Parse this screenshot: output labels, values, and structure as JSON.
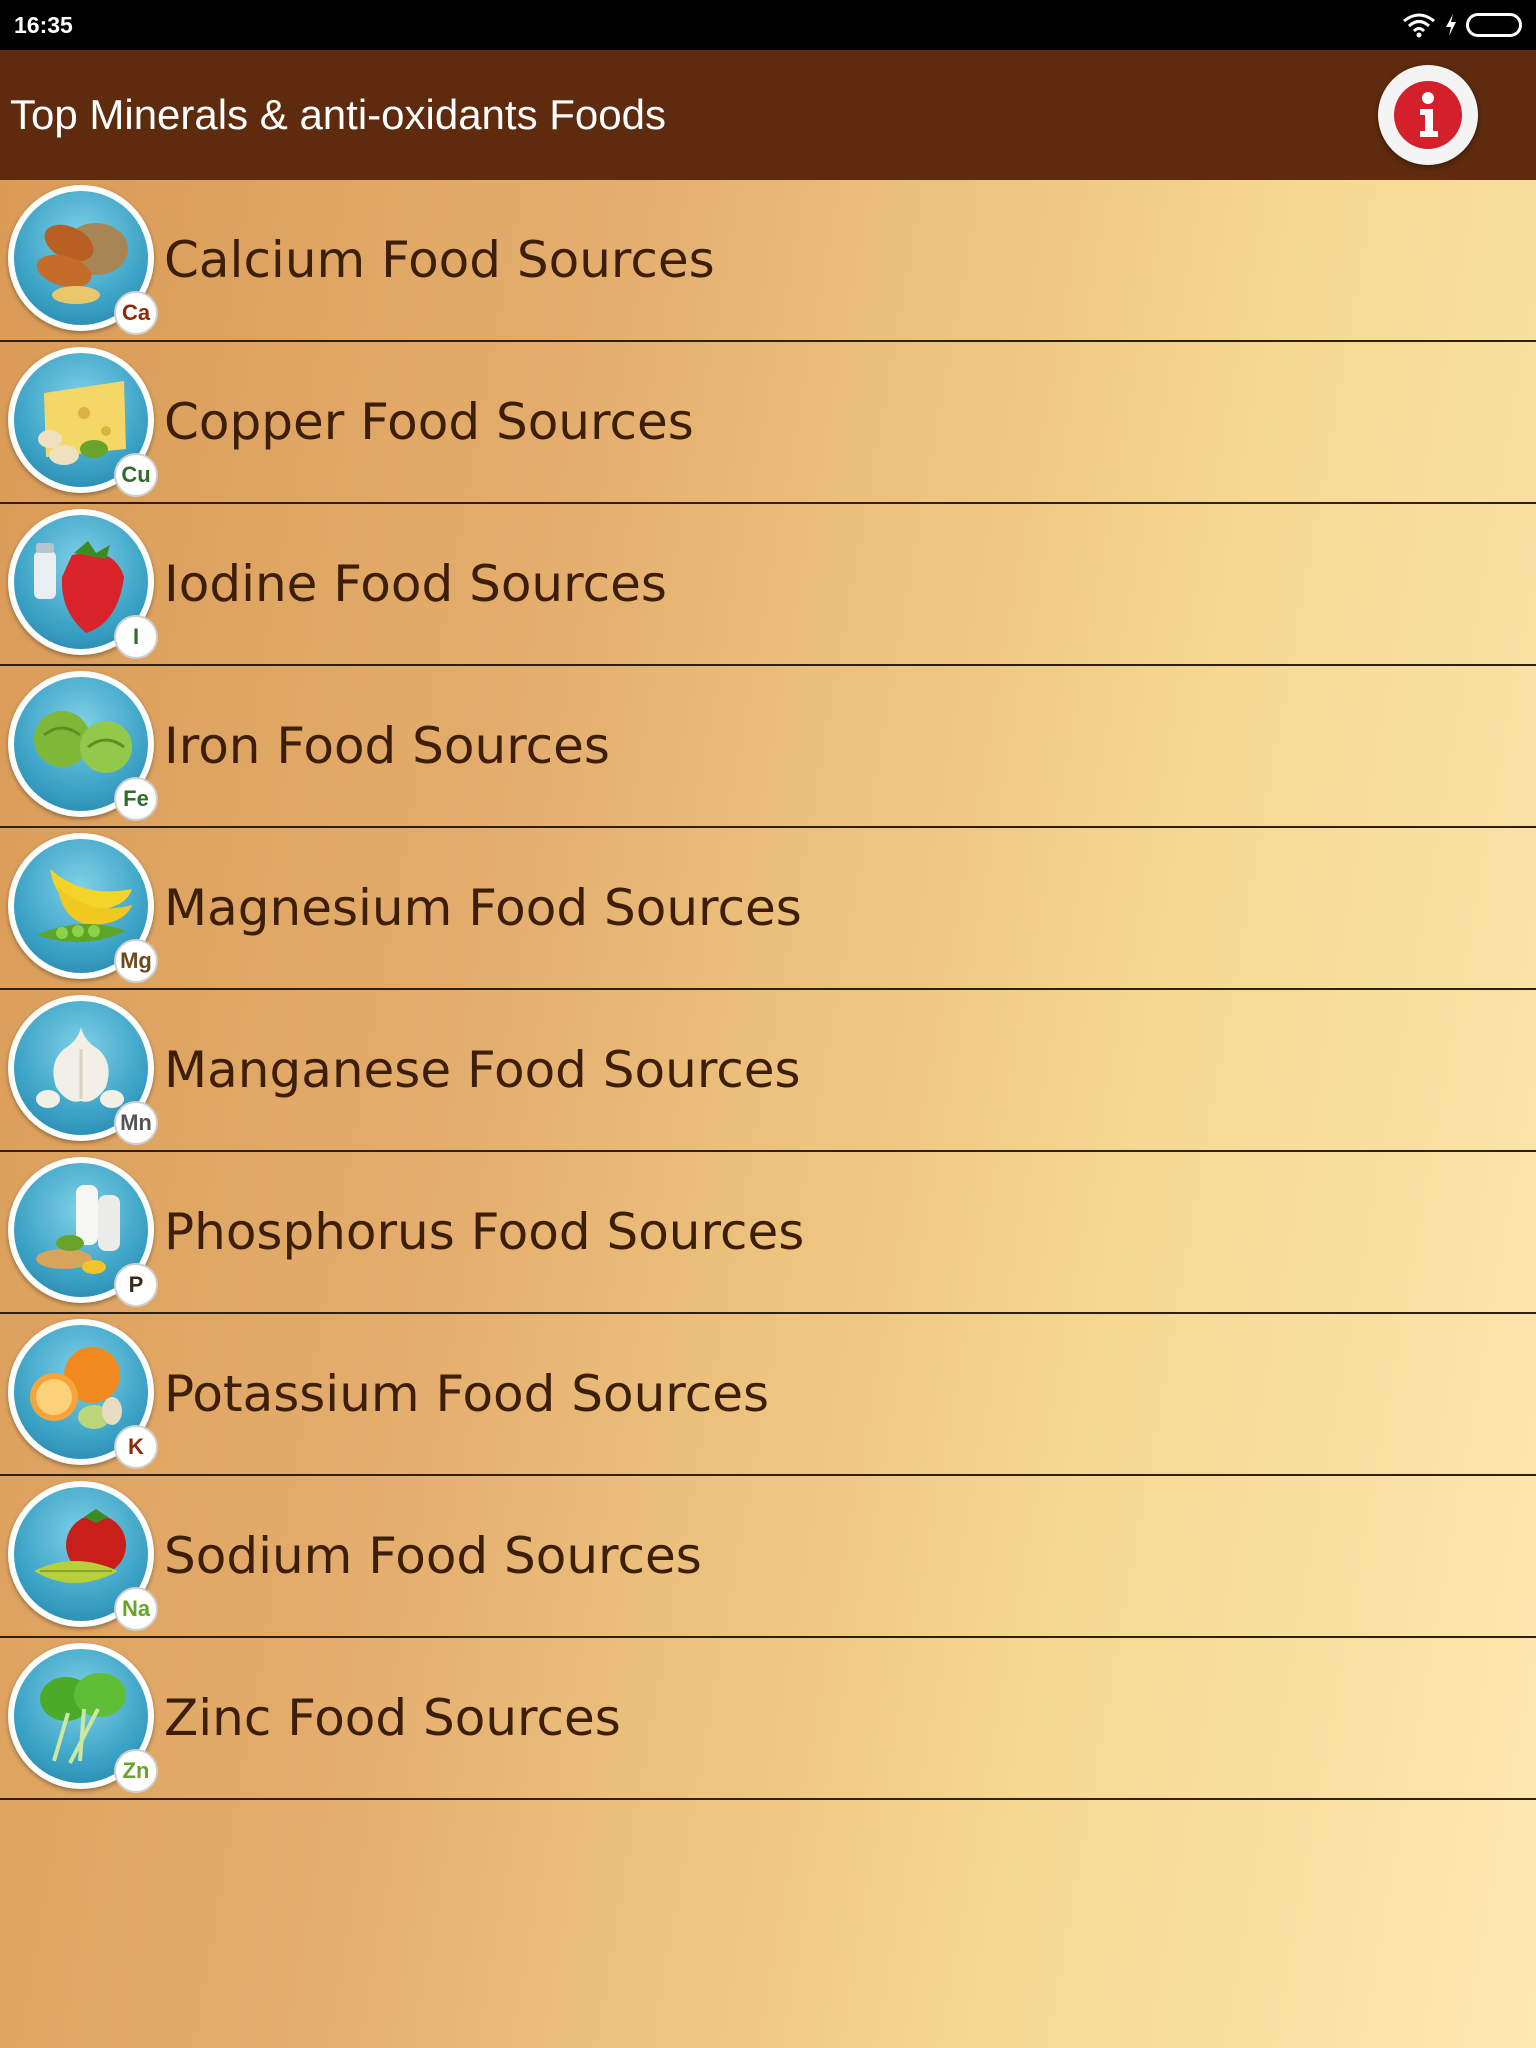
{
  "status": {
    "time": "16:35"
  },
  "app_bar": {
    "title": "Top Minerals & anti-oxidants Foods",
    "info_icon": "info-icon"
  },
  "items": [
    {
      "label": "Calcium Food Sources",
      "symbol": "Ca",
      "symbol_color": "#8b2a0c",
      "icon": "almonds-potato-icon"
    },
    {
      "label": "Copper Food Sources",
      "symbol": "Cu",
      "symbol_color": "#2f6b2a",
      "icon": "cheese-cashew-icon"
    },
    {
      "label": "Iodine Food Sources",
      "symbol": "I",
      "symbol_color": "#2f6b2a",
      "icon": "strawberry-salt-icon"
    },
    {
      "label": "Iron Food Sources",
      "symbol": "Fe",
      "symbol_color": "#2f6b2a",
      "icon": "brussels-sprouts-icon"
    },
    {
      "label": "Magnesium Food Sources",
      "symbol": "Mg",
      "symbol_color": "#6b4a1c",
      "icon": "banana-peas-icon"
    },
    {
      "label": "Manganese Food Sources",
      "symbol": "Mn",
      "symbol_color": "#555555",
      "icon": "garlic-icon"
    },
    {
      "label": "Phosphorus Food Sources",
      "symbol": "P",
      "symbol_color": "#3a2a1a",
      "icon": "milk-peanuts-icon"
    },
    {
      "label": "Potassium Food Sources",
      "symbol": "K",
      "symbol_color": "#8b2a0c",
      "icon": "orange-pistachio-icon"
    },
    {
      "label": "Sodium Food Sources",
      "symbol": "Na",
      "symbol_color": "#6aa32a",
      "icon": "tomato-starfruit-icon"
    },
    {
      "label": "Zinc Food Sources",
      "symbol": "Zn",
      "symbol_color": "#6aa32a",
      "icon": "spinach-icon"
    }
  ]
}
